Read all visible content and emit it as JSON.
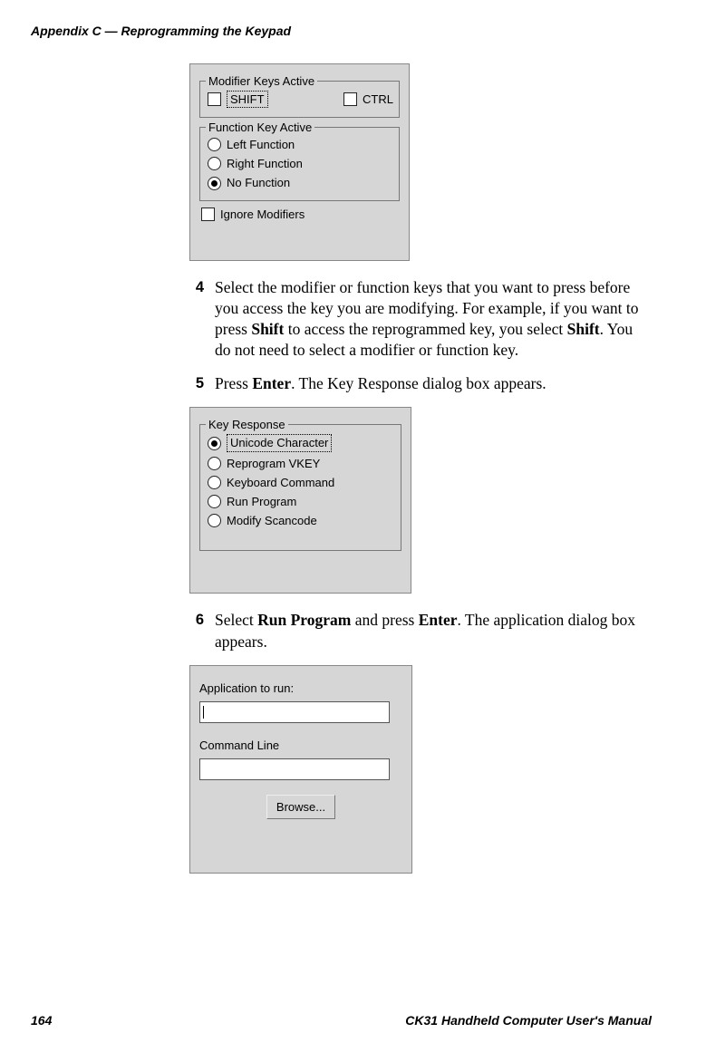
{
  "header": {
    "running_head": "Appendix C — Reprogramming the Keypad"
  },
  "shot_modifier": {
    "group_modifier": {
      "legend": "Modifier Keys Active",
      "shift_label": "SHIFT",
      "ctrl_label": "CTRL"
    },
    "group_function": {
      "legend": "Function Key Active",
      "opt_left": "Left Function",
      "opt_right": "Right Function",
      "opt_none": "No Function"
    },
    "ignore_label": "Ignore Modifiers"
  },
  "steps": {
    "s4": {
      "num": "4",
      "text_a": "Select the modifier or function keys that you want to press before you access the key you are modifying. For example, if you want to press ",
      "bold1": "Shift",
      "text_b": " to access the reprogrammed key, you select ",
      "bold2": "Shift",
      "text_c": ". You do not need to select a modifier or function key."
    },
    "s5": {
      "num": "5",
      "text_a": "Press ",
      "bold1": "Enter",
      "text_b": ". The Key Response dialog box appears."
    },
    "s6": {
      "num": "6",
      "text_a": "Select ",
      "bold1": "Run Program",
      "text_b": " and press ",
      "bold2": "Enter",
      "text_c": ". The application dialog box appears."
    }
  },
  "shot_keyresponse": {
    "legend": "Key Response",
    "opt_unicode": "Unicode Character",
    "opt_vkey": "Reprogram VKEY",
    "opt_kbcmd": "Keyboard Command",
    "opt_run": "Run Program",
    "opt_scan": "Modify Scancode"
  },
  "shot_application": {
    "label_app": "Application to run:",
    "label_cmd": "Command Line",
    "browse": "Browse..."
  },
  "footer": {
    "page_num": "164",
    "doc_title": "CK31 Handheld Computer User's Manual"
  }
}
